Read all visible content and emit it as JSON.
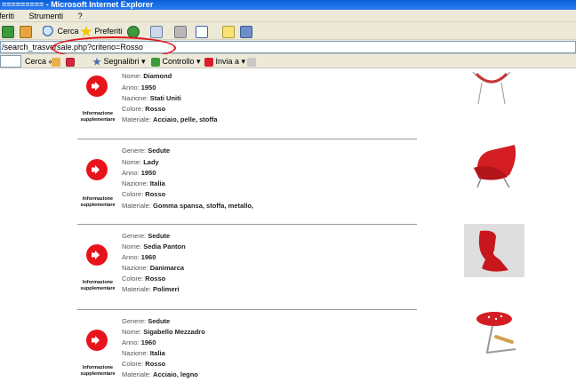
{
  "window": {
    "title": "========= - Microsoft Internet Explorer"
  },
  "menu": [
    "eferiti",
    "Strumenti",
    "?"
  ],
  "toolbar": {
    "search": "Cerca",
    "favorites": "Preferiti"
  },
  "address": {
    "url": "/search_trasversale.php?criterio=Rosso"
  },
  "links": {
    "search": "Cerca",
    "bookmarks": "Segnalibri",
    "check": "Controllo",
    "send": "Invia a"
  },
  "info_label": "Informazione supplementare",
  "labels": {
    "genre": "Genere:",
    "name": "Nome:",
    "year": "Anno:",
    "nation": "Nazione:",
    "color": "Colore:",
    "material": "Materiale:"
  },
  "items": [
    {
      "name": "Diamond",
      "year": "1950",
      "nation": "Stati Uniti",
      "color": "Rosso",
      "material": "Acciaio, pelle, stoffa"
    },
    {
      "genre": "Sedute",
      "name": "Lady",
      "year": "1950",
      "nation": "Italia",
      "color": "Rosso",
      "material": "Gomma spansa, stoffa, metallo,"
    },
    {
      "genre": "Sedute",
      "name": "Sedia Panton",
      "year": "1960",
      "nation": "Danimarca",
      "color": "Rosso",
      "material": "Polimeri"
    },
    {
      "genre": "Sedute",
      "name": "Sigabello Mezzadro",
      "year": "1960",
      "nation": "Italia",
      "color": "Rosso",
      "material": "Acciaio, legno"
    }
  ],
  "colors": {
    "accent": "#e8141c",
    "titlebar": "#0a5fd8",
    "chrome": "#ece9d8"
  }
}
